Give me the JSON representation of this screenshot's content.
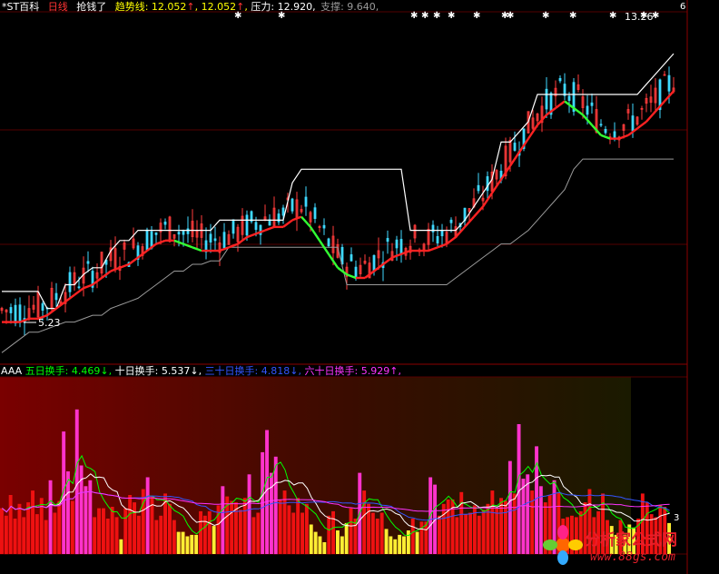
{
  "header_top": {
    "name": "*ST百科",
    "period": "日线",
    "flag": "抢钱了",
    "trend_label": "趋势线:",
    "trend_value1": "12.052",
    "trend_value2": "12.052",
    "press_label": "压力:",
    "press_value": "12.920",
    "support_label": "支撑:",
    "support_value": "9.640",
    "arrow": "↑",
    "colors": {
      "name": "#ffffff",
      "period": "#ff3333",
      "flag": "#ffffff",
      "trend": "#ffff00",
      "press": "#ffffff",
      "support": "#9a9a9a"
    }
  },
  "header_bottom": {
    "prefix": "AAA",
    "m5_label": "五日换手:",
    "m5_value": "4.469",
    "m5_arrow": "↓",
    "m10_label": "十日换手:",
    "m10_value": "5.537",
    "m10_arrow": "↓",
    "m30_label": "三十日换手:",
    "m30_value": "4.818",
    "m30_arrow": "↓",
    "m60_label": "六十日换手:",
    "m60_value": "5.929",
    "m60_arrow": "↑",
    "colors": {
      "prefix": "#ffffff",
      "m5": "#00ff00",
      "m10": "#ffffff",
      "m30": "#3355ff",
      "m60": "#ff33ff"
    }
  },
  "annotations": {
    "low_price": "5.23",
    "high_price": "13.26",
    "right_top_tick": "6",
    "right_bottom_tick": "3"
  },
  "watermark": {
    "text": "分析家公式网",
    "url": "www.88gs.com"
  },
  "chart_data": [
    {
      "type": "line",
      "title": "",
      "note": "Daily candlestick price chart with trend line (red/green), pressure line (white) and support line (grey)",
      "x": [
        0,
        10,
        20,
        30,
        40,
        50,
        60,
        70,
        80,
        90,
        100,
        110,
        120,
        130,
        140,
        150,
        160,
        170,
        180,
        190,
        200,
        210,
        220,
        230,
        240,
        250,
        260,
        270,
        280,
        290,
        300,
        310,
        320,
        330,
        340,
        350,
        360,
        370,
        380,
        390,
        400,
        410,
        420,
        430,
        440,
        450,
        460,
        470,
        480,
        490,
        500,
        510,
        520,
        530,
        540,
        550,
        560,
        570,
        580,
        590,
        600,
        610,
        620,
        630,
        640,
        650,
        660,
        670,
        680,
        690,
        700,
        710,
        720,
        730,
        740
      ],
      "series": [
        {
          "values": [
            5.5,
            5.5,
            5.5,
            5.6,
            5.6,
            5.7,
            5.9,
            6.1,
            6.3,
            6.5,
            6.6,
            6.8,
            7.0,
            7.1,
            7.2,
            7.4,
            7.6,
            7.8,
            7.9,
            7.9,
            7.8,
            7.7,
            7.6,
            7.6,
            7.6,
            7.7,
            7.8,
            8.0,
            8.1,
            8.2,
            8.3,
            8.3,
            8.5,
            8.6,
            8.3,
            7.9,
            7.5,
            7.1,
            6.9,
            6.8,
            6.8,
            7.0,
            7.2,
            7.4,
            7.5,
            7.6,
            7.6,
            7.6,
            7.7,
            7.8,
            8.0,
            8.3,
            8.6,
            8.9,
            9.3,
            9.7,
            10.1,
            10.5,
            10.9,
            11.3,
            11.6,
            11.8,
            12.0,
            11.8,
            11.6,
            11.3,
            11.0,
            10.9,
            10.9,
            11.0,
            11.2,
            11.4,
            11.7,
            12.0,
            12.3
          ]
        },
        {
          "values": [
            6.4,
            6.4,
            6.4,
            6.4,
            6.4,
            5.9,
            5.9,
            6.6,
            6.6,
            6.9,
            7.1,
            7.1,
            7.6,
            7.9,
            7.9,
            8.2,
            8.2,
            8.2,
            8.2,
            8.2,
            8.2,
            8.2,
            8.2,
            8.2,
            8.5,
            8.5,
            8.5,
            8.5,
            8.5,
            8.5,
            8.5,
            8.5,
            9.6,
            10.0,
            10.0,
            10.0,
            10.0,
            10.0,
            10.0,
            10.0,
            10.0,
            10.0,
            10.0,
            10.0,
            10.0,
            8.2,
            8.2,
            8.2,
            8.2,
            8.2,
            8.2,
            8.5,
            8.9,
            9.3,
            9.7,
            10.8,
            10.8,
            11.1,
            11.4,
            12.2,
            12.2,
            12.2,
            12.2,
            12.2,
            12.2,
            12.2,
            12.2,
            12.2,
            12.2,
            12.2,
            12.2,
            12.5,
            12.8,
            13.1,
            13.4
          ]
        },
        {
          "values": [
            4.6,
            4.8,
            5.0,
            5.2,
            5.2,
            5.3,
            5.4,
            5.5,
            5.5,
            5.6,
            5.7,
            5.7,
            5.9,
            6.0,
            6.1,
            6.2,
            6.4,
            6.6,
            6.8,
            7.0,
            7.0,
            7.2,
            7.2,
            7.3,
            7.3,
            7.7,
            7.7,
            7.7,
            7.7,
            7.7,
            7.7,
            7.7,
            7.7,
            7.7,
            7.7,
            7.7,
            7.7,
            7.7,
            6.6,
            6.6,
            6.6,
            6.6,
            6.6,
            6.6,
            6.6,
            6.6,
            6.6,
            6.6,
            6.6,
            6.6,
            6.8,
            7.0,
            7.2,
            7.4,
            7.6,
            7.8,
            7.8,
            8.0,
            8.2,
            8.5,
            8.8,
            9.1,
            9.4,
            10.0,
            10.3,
            10.3,
            10.3,
            10.3,
            10.3,
            10.3,
            10.3,
            10.3,
            10.3,
            10.3,
            10.3
          ]
        }
      ],
      "ylim": [
        4.5,
        14.5
      ]
    },
    {
      "type": "bar",
      "title": "",
      "note": "Daily turnover-rate bars with 5/10/30/60-day moving average lines",
      "categories_count": 150,
      "values": [
        3.1,
        2.6,
        4.0,
        2.4,
        3.4,
        2.5,
        3.5,
        4.3,
        2.7,
        3.8,
        2.3,
        5.0,
        2.8,
        3.6,
        8.3,
        5.6,
        3.6,
        9.8,
        6.0,
        4.6,
        5.0,
        2.5,
        3.1,
        3.1,
        2.4,
        3.2,
        2.5,
        1.0,
        3.1,
        4.0,
        3.5,
        2.6,
        4.4,
        5.2,
        3.9,
        2.3,
        2.6,
        4.1,
        3.4,
        2.3,
        1.5,
        1.5,
        1.2,
        1.3,
        1.3,
        2.9,
        2.6,
        2.9,
        1.9,
        3.3,
        4.6,
        3.9,
        3.6,
        3.5,
        3.0,
        3.8,
        5.4,
        2.5,
        2.8,
        6.9,
        8.4,
        5.5,
        6.6,
        3.7,
        4.3,
        3.3,
        2.8,
        3.8,
        2.8,
        3.4,
        2.0,
        1.5,
        1.2,
        0.8,
        2.6,
        2.9,
        1.6,
        1.2,
        2.1,
        3.1,
        2.4,
        5.5,
        4.3,
        3.4,
        2.8,
        2.4,
        2.8,
        1.7,
        1.2,
        1.0,
        1.3,
        1.2,
        1.6,
        2.4,
        1.5,
        2.2,
        2.2,
        5.2,
        4.7,
        2.6,
        3.4,
        3.7,
        3.7,
        2.5,
        4.2,
        2.7,
        2.8,
        3.3,
        2.6,
        3.0,
        3.4,
        4.3,
        3.1,
        3.8,
        3.6,
        6.3,
        4.1,
        8.8,
        5.1,
        5.4,
        4.3,
        7.3,
        4.6,
        3.5,
        4.0,
        5.0,
        4.2,
        2.4,
        2.5,
        2.6,
        2.5,
        2.9,
        3.5,
        4.4,
        2.5,
        2.9,
        4.1,
        2.3,
        1.9,
        1.3,
        2.3,
        1.3,
        2.0,
        1.8,
        2.4,
        4.1,
        3.5,
        2.7,
        2.5,
        3.3,
        3.2,
        2.1
      ]
    }
  ]
}
